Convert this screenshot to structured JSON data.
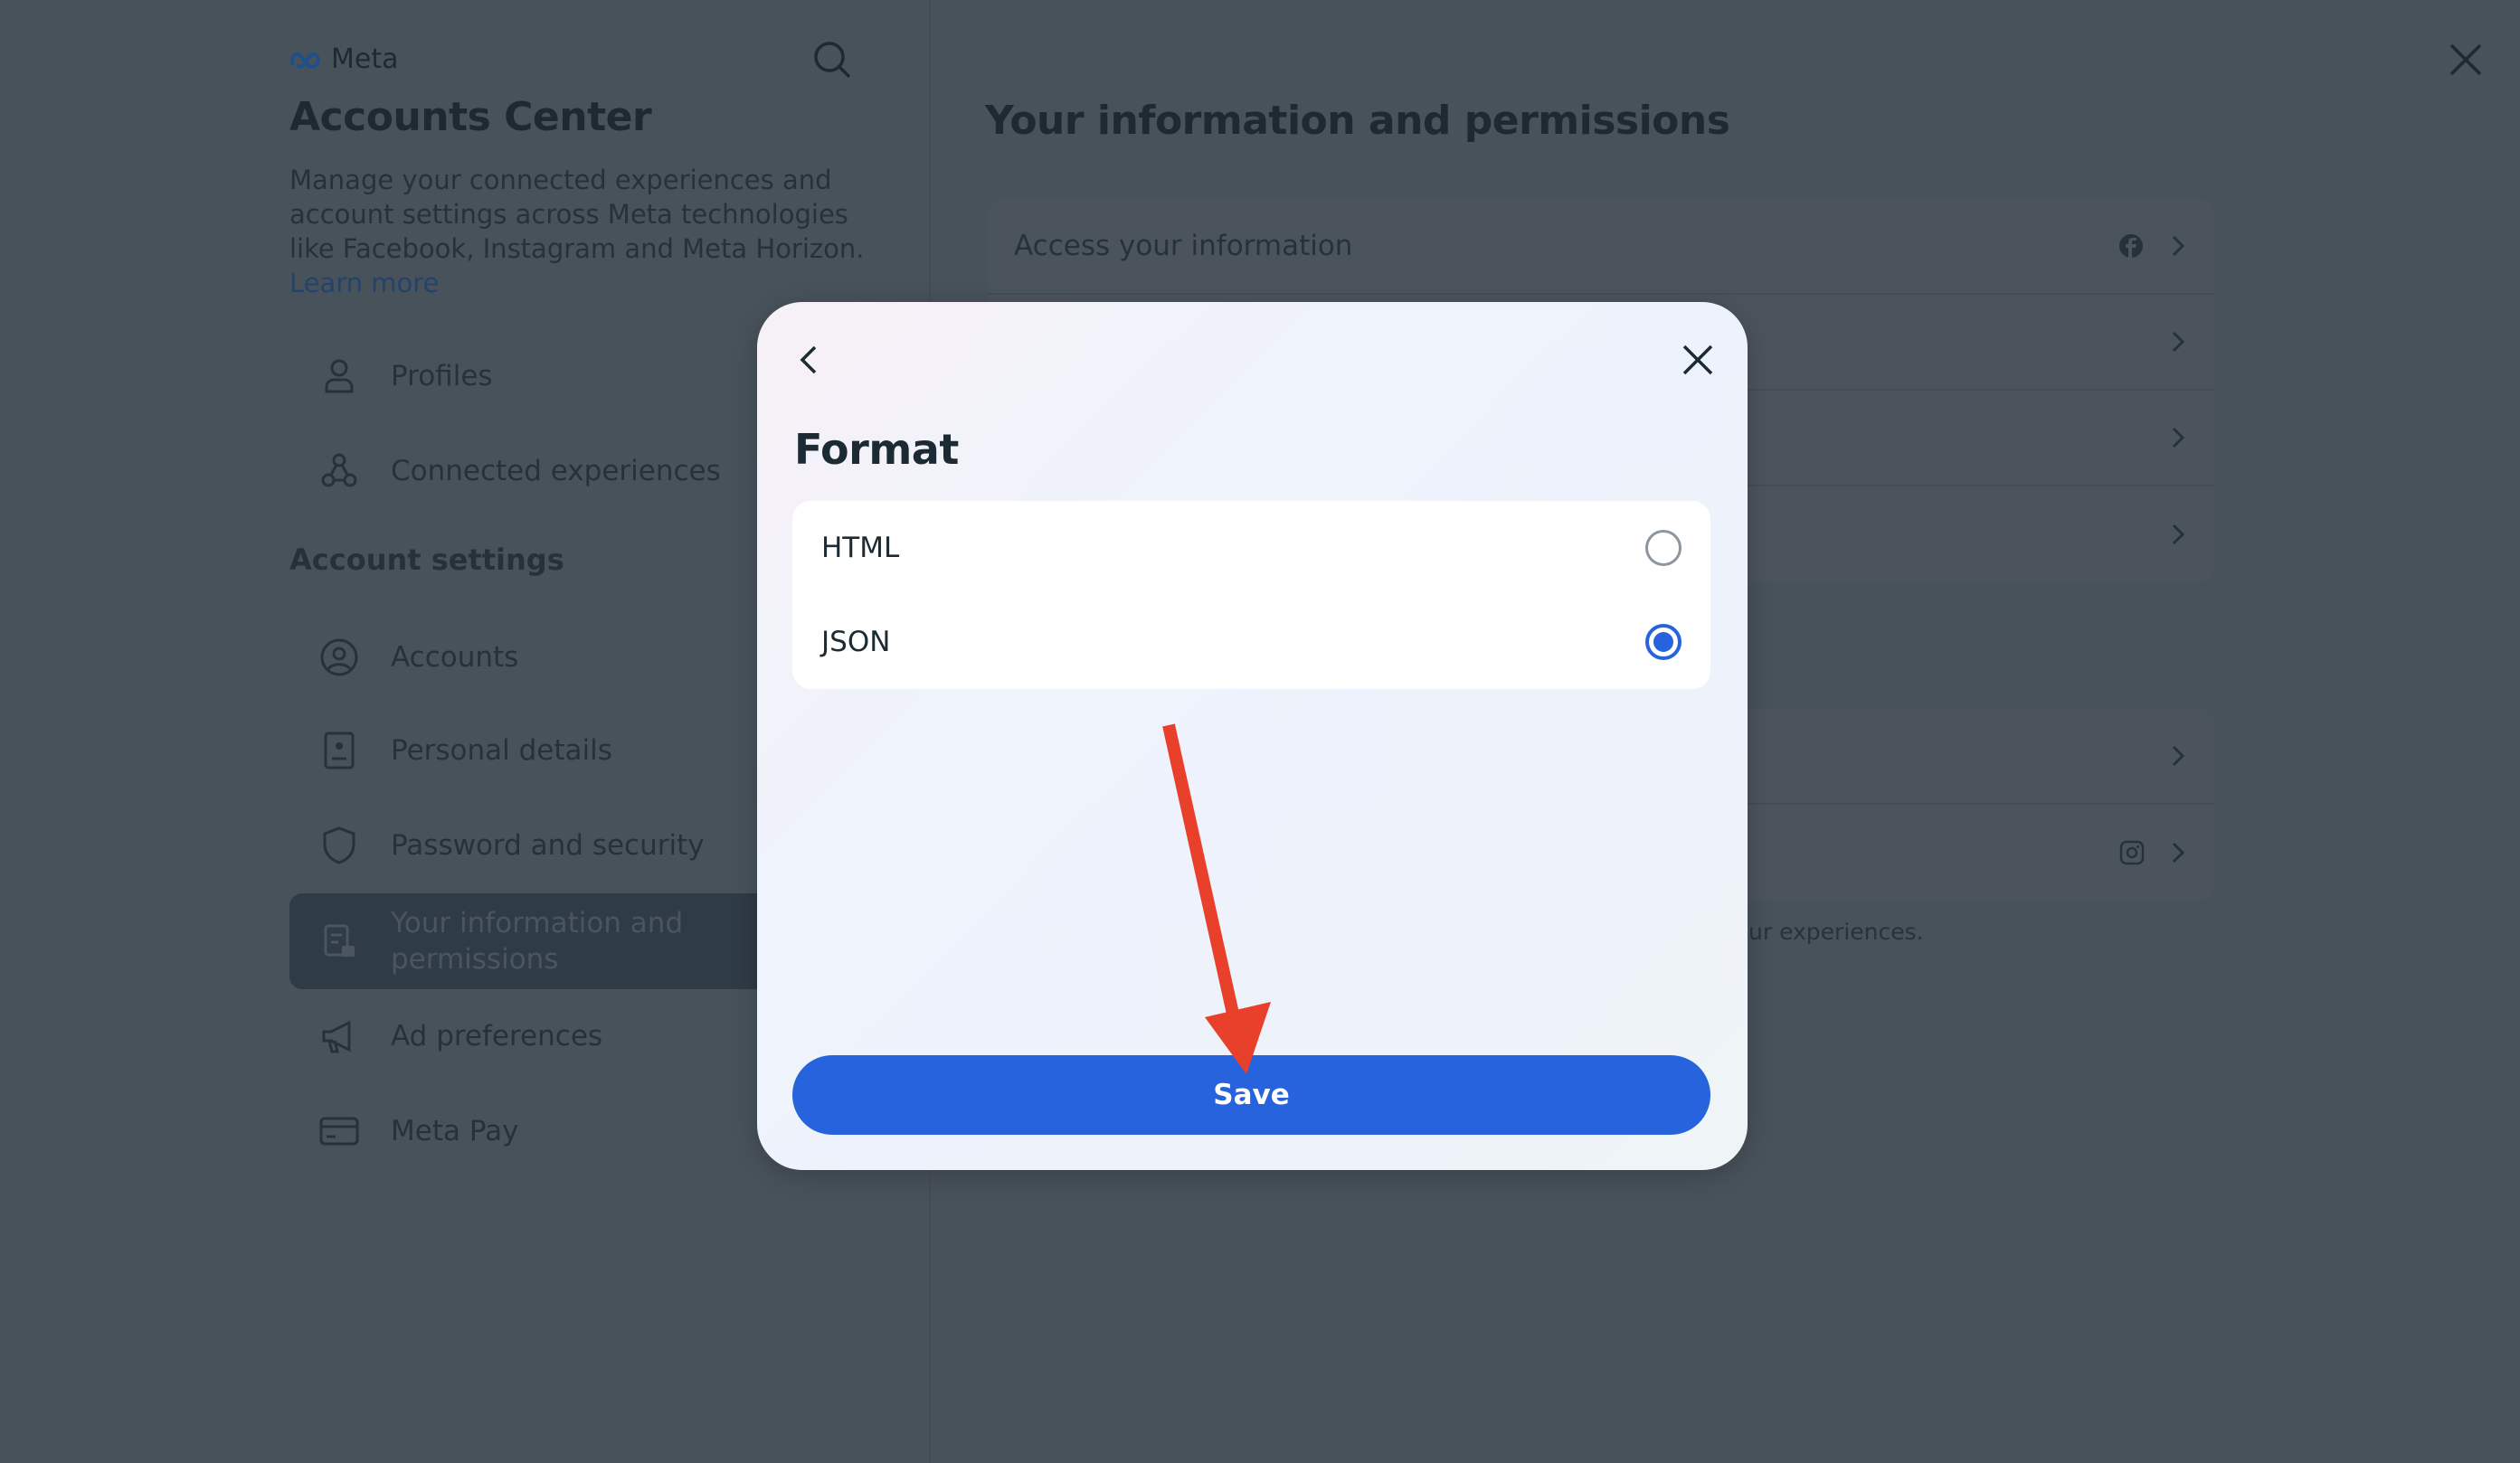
{
  "sidebar": {
    "logo": "Meta",
    "title": "Accounts Center",
    "description": "Manage your connected experiences and account settings across Meta technologies like Facebook, Instagram and Meta Horizon.",
    "learn_more": "Learn more",
    "items": [
      {
        "label": "Profiles",
        "icon": "person-icon"
      },
      {
        "label": "Connected experiences",
        "icon": "connected-icon"
      }
    ],
    "section_title": "Account settings",
    "settings": [
      {
        "label": "Accounts",
        "icon": "account-circle-icon"
      },
      {
        "label": "Personal details",
        "icon": "id-card-icon"
      },
      {
        "label": "Password and security",
        "icon": "shield-icon"
      },
      {
        "label": "Your information and permissions",
        "icon": "info-lock-icon",
        "selected": true
      },
      {
        "label": "Ad preferences",
        "icon": "megaphone-icon"
      },
      {
        "label": "Meta Pay",
        "icon": "card-icon"
      }
    ]
  },
  "main": {
    "title": "Your information and permissions",
    "rows": [
      {
        "label": "Access your information",
        "icon": "facebook-icon"
      }
    ],
    "footer_fragment": "ur experiences."
  },
  "modal": {
    "title": "Format",
    "options": [
      {
        "label": "HTML",
        "selected": false
      },
      {
        "label": "JSON",
        "selected": true
      }
    ],
    "save_label": "Save"
  },
  "colors": {
    "accent": "#2763dc",
    "annotation_arrow": "#e8402a"
  }
}
